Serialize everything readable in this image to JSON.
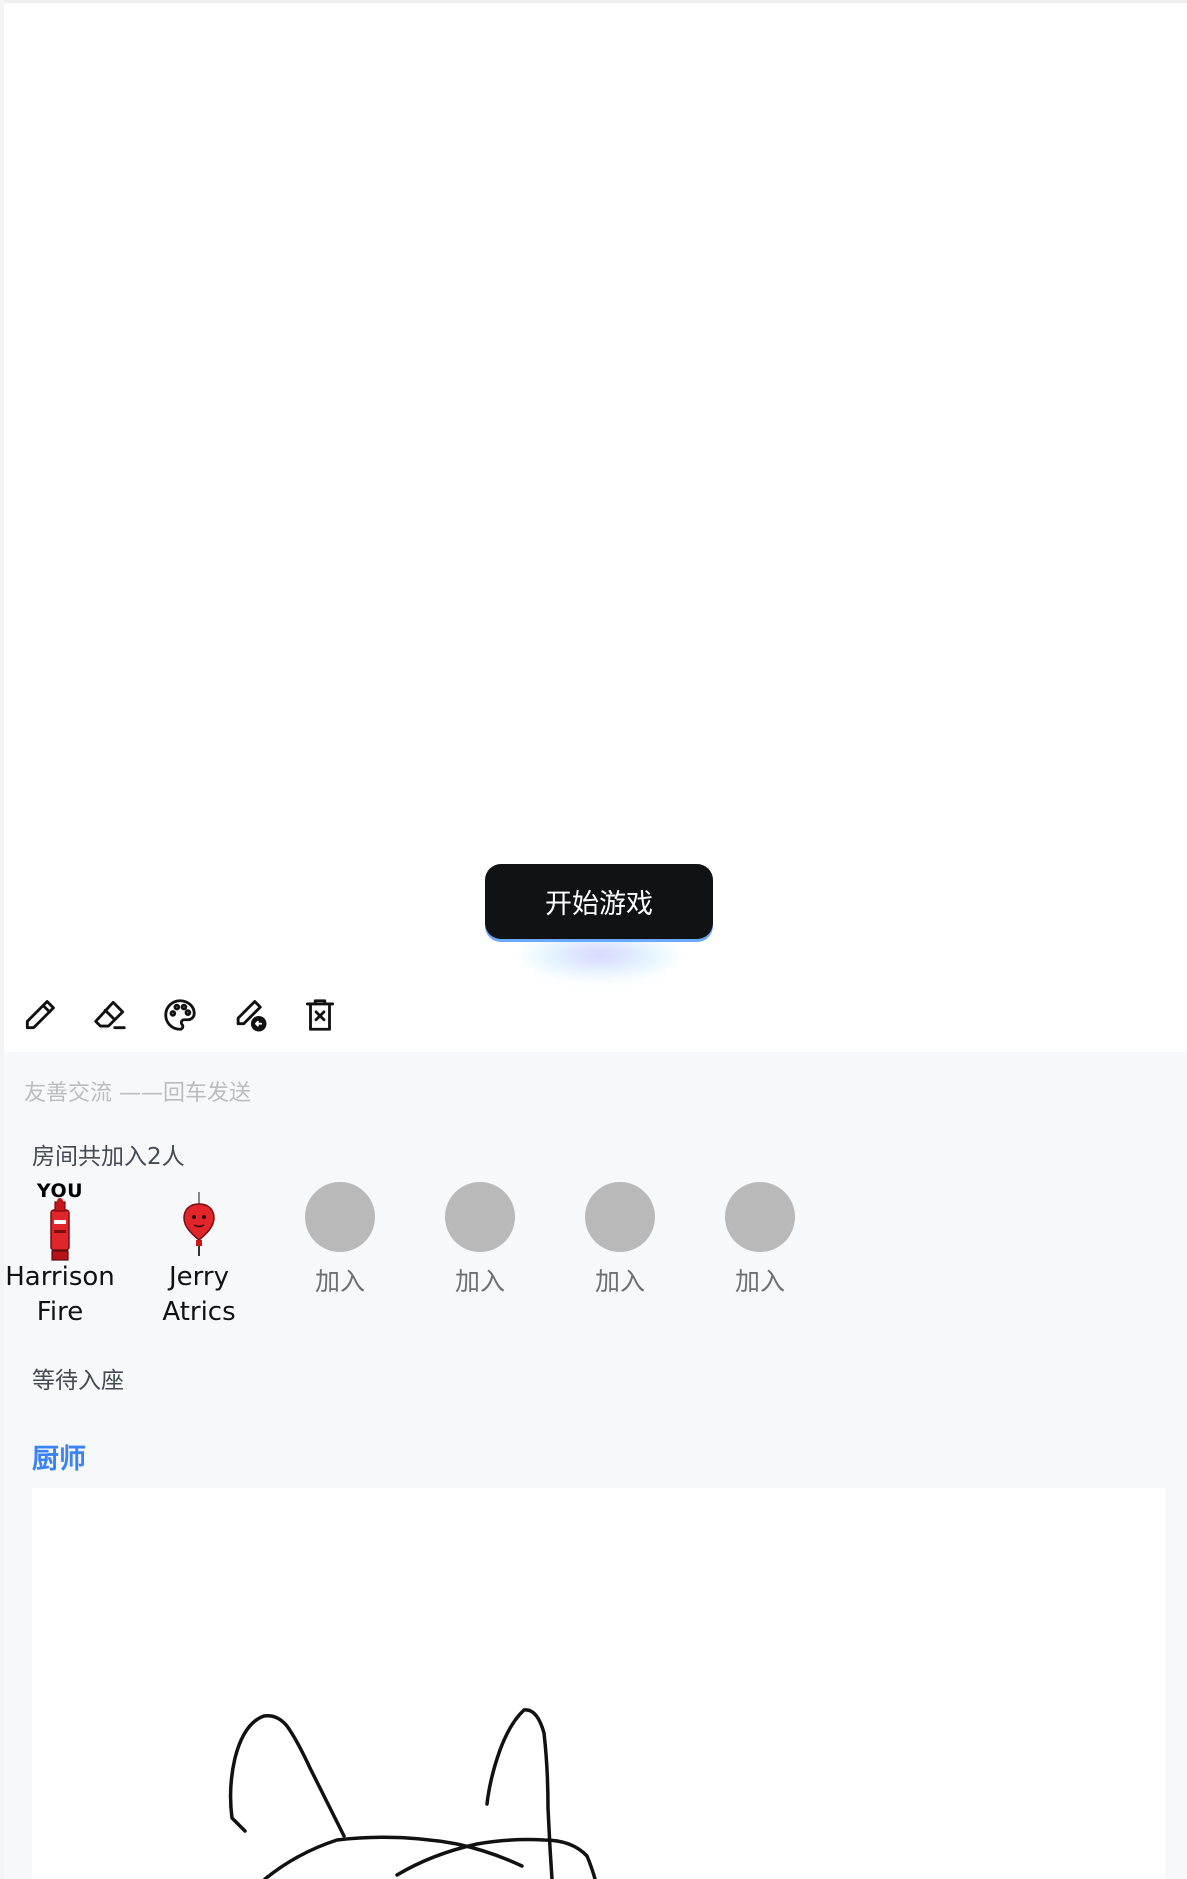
{
  "start_button": {
    "label": "开始游戏"
  },
  "toolbar": {
    "tools": [
      {
        "name": "pencil-icon"
      },
      {
        "name": "eraser-icon"
      },
      {
        "name": "palette-icon"
      },
      {
        "name": "undo-pen-icon"
      },
      {
        "name": "clear-canvas-icon"
      }
    ]
  },
  "chat": {
    "placeholder": "友善交流 ——回车发送"
  },
  "room": {
    "count_text": "房间共加入2人",
    "you_label": "YOU",
    "players": [
      {
        "name": "Harrison\nFire",
        "name_line1": "Harrison",
        "name_line2": "Fire",
        "is_you": true,
        "avatar": "fire-extinguisher-avatar"
      },
      {
        "name_line1": "Jerry",
        "name_line2": "Atrics",
        "is_you": false,
        "avatar": "balloon-avatar"
      }
    ],
    "empty_seats": [
      {
        "label": "加入"
      },
      {
        "label": "加入"
      },
      {
        "label": "加入"
      },
      {
        "label": "加入"
      }
    ],
    "waiting_text": "等待入座"
  },
  "role": {
    "title": "厨师"
  },
  "colors": {
    "accent": "#3b82f6",
    "button_bg": "#111214",
    "empty_seat": "#b9b9b9",
    "panel_bg": "#f7f8fa"
  }
}
